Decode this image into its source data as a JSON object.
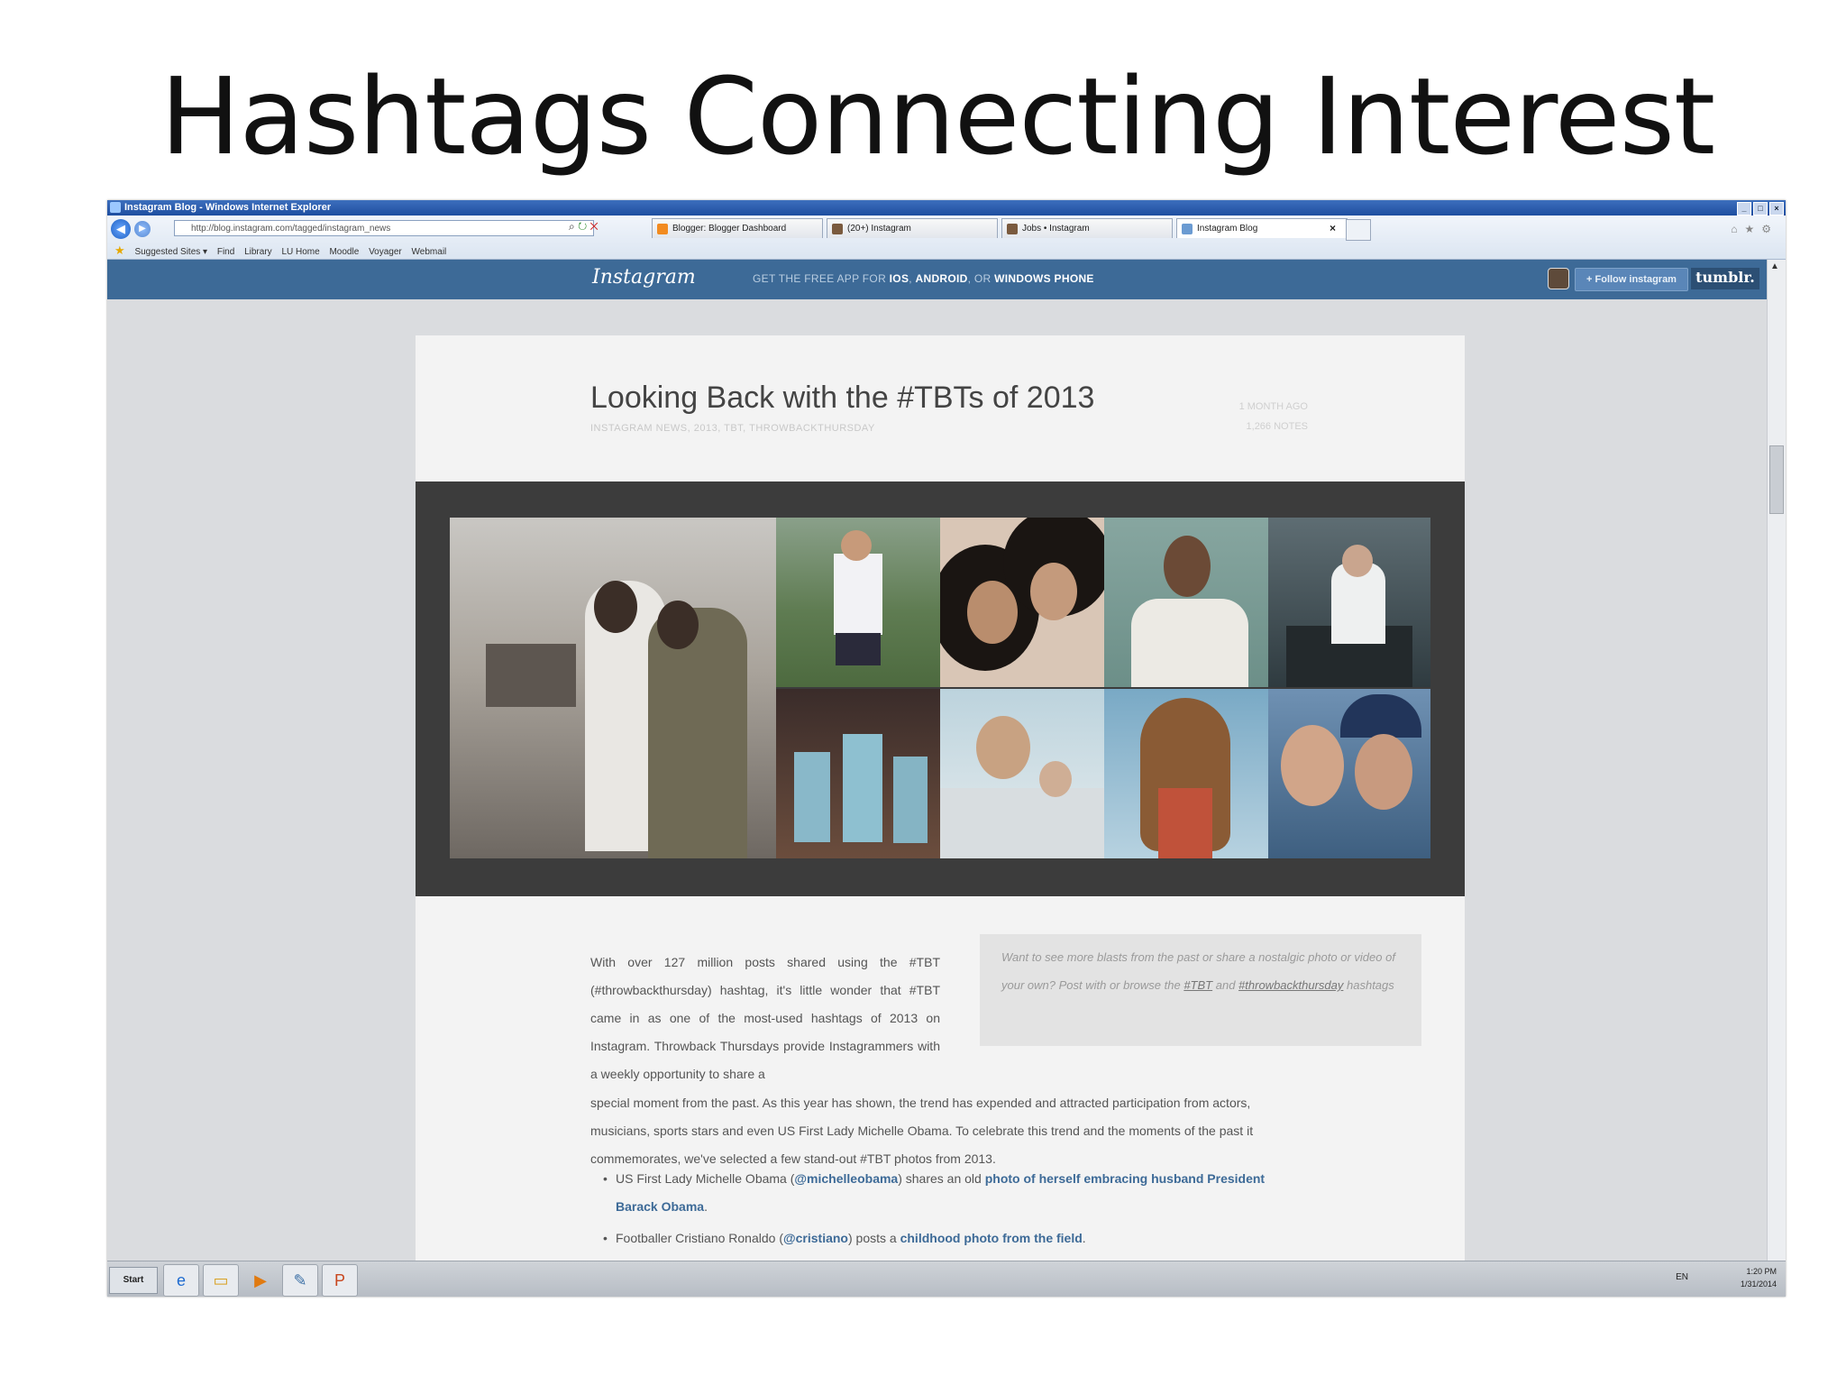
{
  "slide": {
    "title": "Hashtags Connecting Interest"
  },
  "browser": {
    "window_title": "Instagram Blog - Windows Internet Explorer",
    "address": "http://blog.instagram.com/tagged/instagram_news",
    "tabs": [
      {
        "label": "Blogger: Blogger Dashboard",
        "color": "#f28b20"
      },
      {
        "label": "(20+) Instagram",
        "color": "#7a5a3e"
      },
      {
        "label": "Jobs • Instagram",
        "color": "#7a5a3e"
      },
      {
        "label": "Instagram Blog",
        "color": "#6b9bd2"
      }
    ],
    "favorites": [
      "Suggested Sites ▾",
      "Find",
      "Library",
      "LU Home",
      "Moodle",
      "Voyager",
      "Webmail"
    ]
  },
  "blog_bar": {
    "logo": "Instagram",
    "tagline_prefix": "GET THE FREE APP FOR ",
    "tagline_ios": "IOS",
    "tagline_sep1": ", ",
    "tagline_android": "ANDROID",
    "tagline_sep2": ", OR ",
    "tagline_wp": "WINDOWS PHONE",
    "follow_label": "+ Follow instagram",
    "tumblr_label": "tumblr."
  },
  "post": {
    "title": "Looking Back with the #TBTs of 2013",
    "tags": "INSTAGRAM NEWS, 2013, TBT, THROWBACKTHURSDAY",
    "age": "1 MONTH AGO",
    "notes": "1,266 NOTES",
    "body_col": "With over 127 million posts shared using the #TBT (#throwbackthursday) hashtag, it's little wonder that #TBT came in as one of the most-used hashtags of 2013 on Instagram. Throwback Thursdays provide Instagrammers with a weekly opportunity to share a",
    "body_full": "special moment from the past. As this year has shown, the trend has expended and attracted participation from actors, musicians, sports stars and even US First Lady Michelle Obama. To celebrate this trend and the moments of the past it commemorates, we've selected a few stand-out #TBT photos from 2013.",
    "callout_text": "Want to see more blasts from the past or share a nostalgic photo or video of your own? Post with or browse the ",
    "callout_tbt": "#TBT",
    "callout_and": " and ",
    "callout_tbt2": "#throwbackthursday",
    "callout_end": " hashtags",
    "bullet1_a": "US First Lady Michelle Obama (",
    "bullet1_user": "@michelleobama",
    "bullet1_b": ") shares an old ",
    "bullet1_link": "photo of herself embracing husband President Barack Obama",
    "bullet1_end": ".",
    "bullet2_a": "Footballer Cristiano Ronaldo (",
    "bullet2_user": "@cristiano",
    "bullet2_b": ") posts a ",
    "bullet2_link": "childhood photo from the field",
    "bullet2_end": "."
  },
  "taskbar": {
    "start_label": "Start",
    "lang": "EN",
    "time": "1:20 PM",
    "date": "1/31/2014"
  }
}
